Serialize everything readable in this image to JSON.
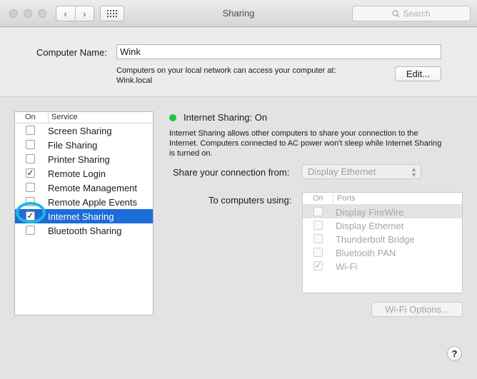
{
  "window": {
    "title": "Sharing",
    "search_placeholder": "Search",
    "nav_back": "‹",
    "nav_forward": "›"
  },
  "computer_name": {
    "label": "Computer Name:",
    "value": "Wink",
    "note_line1": "Computers on your local network can access your computer at:",
    "note_line2": "Wink.local",
    "edit_label": "Edit..."
  },
  "services": {
    "header_on": "On",
    "header_service": "Service",
    "items": [
      {
        "label": "Screen Sharing",
        "on": ""
      },
      {
        "label": "File Sharing",
        "on": ""
      },
      {
        "label": "Printer Sharing",
        "on": ""
      },
      {
        "label": "Remote Login",
        "on": "✓"
      },
      {
        "label": "Remote Management",
        "on": ""
      },
      {
        "label": "Remote Apple Events",
        "on": ""
      },
      {
        "label": "Internet Sharing",
        "on": "✓"
      },
      {
        "label": "Bluetooth Sharing",
        "on": ""
      }
    ],
    "selected_index": 6
  },
  "detail": {
    "status": "Internet Sharing: On",
    "status_color": "#29c23f",
    "description": "Internet Sharing allows other computers to share your connection to the Internet. Computers connected to AC power won't sleep while Internet Sharing is turned on.",
    "share_from_label": "Share your connection from:",
    "share_from_value": "Display Ethernet",
    "to_label": "To computers using:",
    "ports_header_on": "On",
    "ports_header_ports": "Ports",
    "ports": [
      {
        "label": "Display FireWire",
        "on": ""
      },
      {
        "label": "Display Ethernet",
        "on": ""
      },
      {
        "label": "Thunderbolt Bridge",
        "on": ""
      },
      {
        "label": "Bluetooth PAN",
        "on": ""
      },
      {
        "label": "Wi-Fi",
        "on": "✓"
      }
    ],
    "wifi_options_label": "Wi-Fi Options...",
    "help_label": "?"
  },
  "colors": {
    "selection": "#1c6cd9",
    "highlight_ring": "#21b5e8"
  }
}
